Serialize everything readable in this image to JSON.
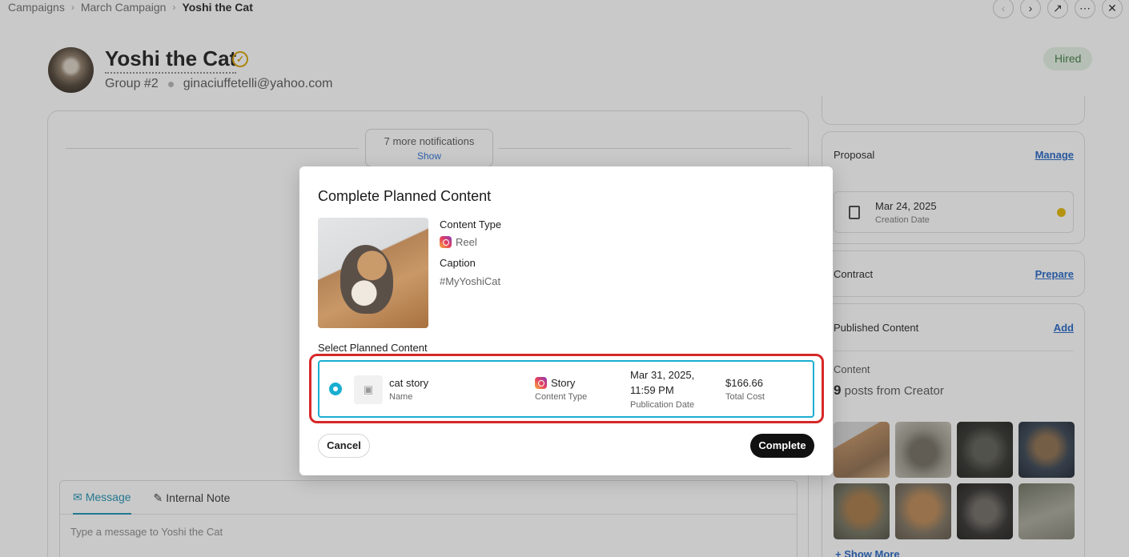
{
  "breadcrumb": {
    "items": [
      "Campaigns",
      "March Campaign"
    ],
    "current": "Yoshi the Cat"
  },
  "topnav": {
    "icons": [
      "chevron-left-icon",
      "chevron-right-icon",
      "external-link-icon",
      "more-icon",
      "close-icon"
    ]
  },
  "creator": {
    "name": "Yoshi the Cat",
    "group": "Group #2",
    "email": "ginaciuffetelli@yahoo.com",
    "status": "Hired"
  },
  "thread": {
    "notifications_text": "7 more notifications",
    "show_label": "Show"
  },
  "composer": {
    "tab_message": "Message",
    "tab_note": "Internal Note",
    "placeholder": "Type a message to Yoshi the Cat"
  },
  "sidebar": {
    "proposal": {
      "title": "Proposal",
      "action": "Manage",
      "date": "Mar 24, 2025",
      "date_label": "Creation Date"
    },
    "contract": {
      "title": "Contract",
      "action": "Prepare"
    },
    "published": {
      "title": "Published Content",
      "action": "Add",
      "content_label": "Content",
      "count": "9",
      "count_suffix": "posts from Creator",
      "show_more": "Show More"
    }
  },
  "modal": {
    "title": "Complete Planned Content",
    "content_type_label": "Content Type",
    "content_type_value": "Reel",
    "caption_label": "Caption",
    "caption_value": "#MyYoshiCat",
    "select_label": "Select Planned Content",
    "option": {
      "name": "cat story",
      "name_label": "Name",
      "type": "Story",
      "type_label": "Content Type",
      "date_line1": "Mar 31, 2025,",
      "date_line2": "11:59 PM",
      "date_label": "Publication Date",
      "cost": "$166.66",
      "cost_label": "Total Cost"
    },
    "cancel_label": "Cancel",
    "complete_label": "Complete"
  },
  "colors": {
    "accent": "#1aaed1",
    "highlight": "#d62828",
    "link": "#1f63c4",
    "status_hired_bg": "#e3f2e4",
    "pending_dot": "#e2b400"
  }
}
